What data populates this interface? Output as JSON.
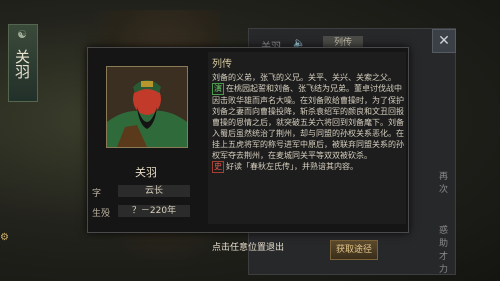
{
  "side": {
    "plate_symbol": "☯",
    "vertical_name": "关羽",
    "left_tag": "⚙"
  },
  "right_panel": {
    "title": "关羽",
    "speaker_icon": "speaker-icon",
    "tab": "列传",
    "side_text_1": "再次",
    "side_text_2": "惑助",
    "side_text_3": "才力",
    "acquire_label": "获取途径",
    "close_icon": "close-x-icon"
  },
  "popup": {
    "hero_name": "关羽",
    "style_label": "字",
    "style_value": "云长",
    "life_label": "生殁",
    "life_value": "？－220年",
    "bio_title": "列传",
    "bio_intro": "刘备的义弟，张飞的义兄。关平、关兴、关索之父。",
    "tag_yan": "演",
    "bio_yan": "在桃园起誓和刘备、张飞结为兄弟。董卓讨伐战中因击败华雄而声名大噪。在刘备败给曹操时，为了保护刘备之妻而向曹操投降，斩杀袁绍军的颜良和文丑回报曹操的恩情之后，就突破五关六将回到刘备麾下。刘备入蜀后虽然统治了荆州，却与同盟的孙权关系恶化。在挂上五虎将军的称号进军中原后，被联弃同盟关系的孙权军夺去荆州，在麦城同关平等双双被砍杀。",
    "tag_shi": "史",
    "bio_shi": "好读「春秋左氏传」，并熟谙其内容。"
  },
  "exit_hint": "点击任意位置退出"
}
